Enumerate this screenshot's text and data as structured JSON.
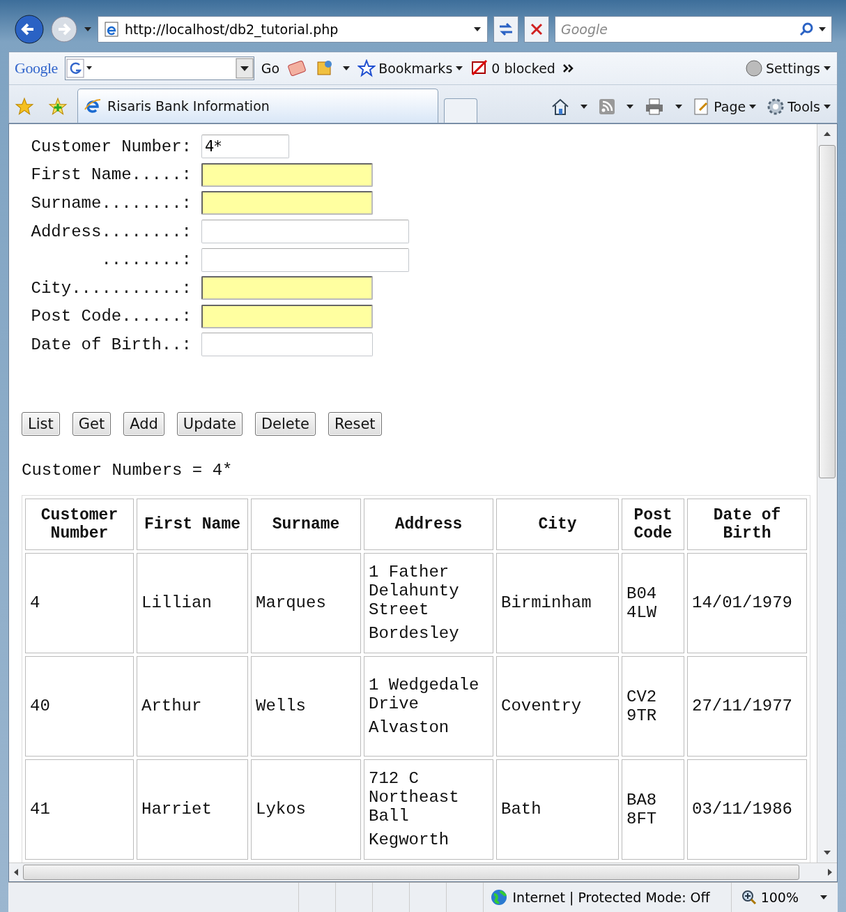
{
  "address_bar": {
    "url": "http://localhost/db2_tutorial.php",
    "search_placeholder": "Google"
  },
  "google_bar": {
    "logo": "Google",
    "go": "Go",
    "bookmarks": "Bookmarks",
    "blocked": "0 blocked",
    "settings": "Settings"
  },
  "tabs": [
    {
      "label": "Risaris Bank Information",
      "selected": true
    }
  ],
  "command_bar": {
    "page": "Page",
    "tools": "Tools"
  },
  "form": {
    "fields": [
      {
        "label": "Customer Number:",
        "value": "4*",
        "highlighted": false,
        "kind": "short"
      },
      {
        "label": "First Name.....:",
        "highlighted": true,
        "kind": "medium"
      },
      {
        "label": "Surname........:",
        "highlighted": true,
        "kind": "medium"
      },
      {
        "label": "Address........:",
        "highlighted": false,
        "kind": "long"
      },
      {
        "label": "........:",
        "highlighted": false,
        "kind": "long"
      },
      {
        "label": "City...........:",
        "highlighted": true,
        "kind": "medium"
      },
      {
        "label": "Post Code......:",
        "highlighted": true,
        "kind": "medium"
      },
      {
        "label": "Date of Birth..:",
        "highlighted": false,
        "kind": "medium"
      }
    ],
    "buttons": [
      "List",
      "Get",
      "Add",
      "Update",
      "Delete",
      "Reset"
    ]
  },
  "result_text": "Customer Numbers = 4*",
  "table": {
    "columns": [
      "Customer Number",
      "First Name",
      "Surname",
      "Address",
      "City",
      "Post Code",
      "Date of Birth"
    ],
    "rows": [
      {
        "cells": [
          "4",
          "Lillian",
          "Marques",
          [
            "1 Father Delahunty Street",
            "Bordesley"
          ],
          "Birminham",
          "B04 4LW",
          "14/01/1979"
        ]
      },
      {
        "cells": [
          "40",
          "Arthur",
          "Wells",
          [
            "1 Wedgedale Drive",
            "Alvaston"
          ],
          "Coventry",
          "CV2 9TR",
          "27/11/1977"
        ]
      },
      {
        "cells": [
          "41",
          "Harriet",
          "Lykos",
          [
            "712 C Northeast Ball",
            "Kegworth"
          ],
          "Bath",
          "BA8 8FT",
          "03/11/1986"
        ]
      }
    ]
  },
  "status_bar": {
    "zone": "Internet | Protected Mode: Off",
    "zoom": "100%"
  }
}
